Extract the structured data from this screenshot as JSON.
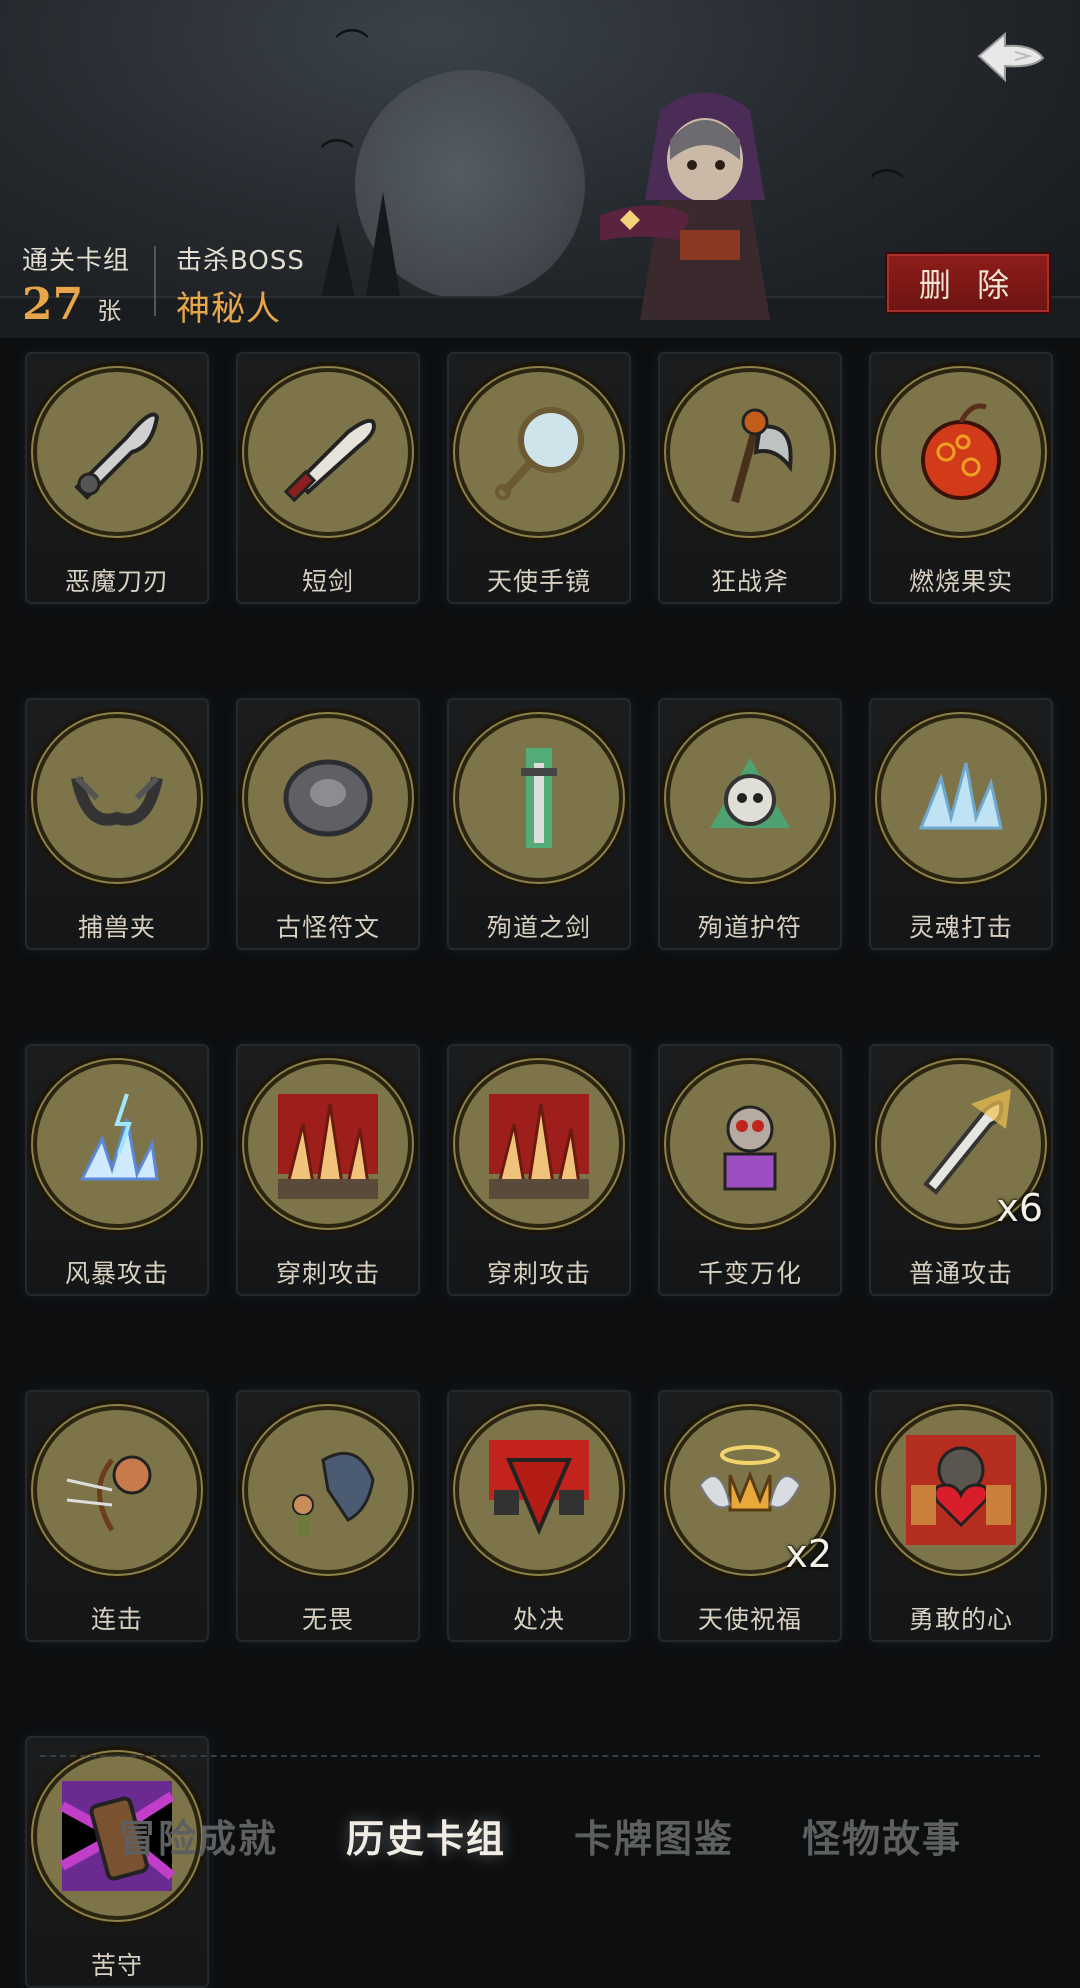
{
  "header": {
    "stats": {
      "deck_label": "通关卡组",
      "deck_count": "27",
      "deck_unit": "张",
      "boss_label": "击杀BOSS",
      "boss_name": "神秘人"
    },
    "delete_label": "删 除",
    "back_icon": "back-arrow-icon"
  },
  "cards": [
    {
      "name": "恶魔刀刃",
      "icon": "demon-blade-icon"
    },
    {
      "name": "短剑",
      "icon": "short-sword-icon"
    },
    {
      "name": "天使手镜",
      "icon": "hand-mirror-icon"
    },
    {
      "name": "狂战斧",
      "icon": "battle-axe-icon"
    },
    {
      "name": "燃烧果实",
      "icon": "burning-fruit-icon"
    },
    {
      "name": "捕兽夹",
      "icon": "bear-trap-icon"
    },
    {
      "name": "古怪符文",
      "icon": "rune-stone-icon"
    },
    {
      "name": "殉道之剑",
      "icon": "martyr-sword-icon"
    },
    {
      "name": "殉道护符",
      "icon": "martyr-amulet-icon"
    },
    {
      "name": "灵魂打击",
      "icon": "soul-strike-icon"
    },
    {
      "name": "风暴攻击",
      "icon": "storm-attack-icon"
    },
    {
      "name": "穿刺攻击",
      "icon": "pierce-attack-icon"
    },
    {
      "name": "穿刺攻击",
      "icon": "pierce-attack-icon"
    },
    {
      "name": "千变万化",
      "icon": "shapeshift-icon"
    },
    {
      "name": "普通攻击",
      "icon": "basic-attack-icon",
      "count": "x6"
    },
    {
      "name": "连击",
      "icon": "archer-combo-icon"
    },
    {
      "name": "无畏",
      "icon": "fearless-icon"
    },
    {
      "name": "处决",
      "icon": "execute-icon"
    },
    {
      "name": "天使祝福",
      "icon": "angel-blessing-icon",
      "count": "x2"
    },
    {
      "name": "勇敢的心",
      "icon": "brave-heart-icon"
    },
    {
      "name": "苦守",
      "icon": "hold-fast-icon"
    }
  ],
  "tabs": [
    {
      "label": "冒险成就",
      "active": false
    },
    {
      "label": "历史卡组",
      "active": true
    },
    {
      "label": "卡牌图鉴",
      "active": false
    },
    {
      "label": "怪物故事",
      "active": false
    }
  ]
}
